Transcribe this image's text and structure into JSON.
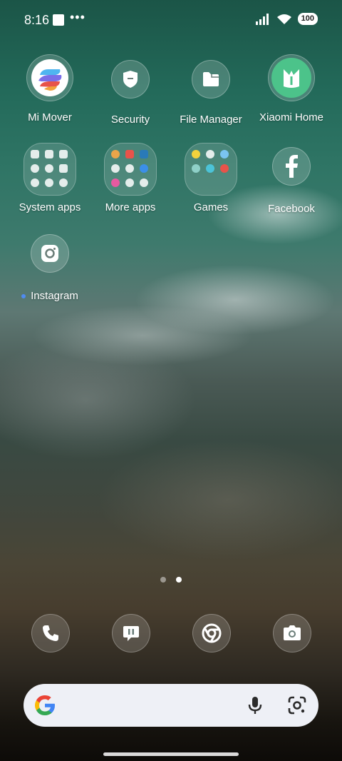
{
  "status_bar": {
    "time": "8:16",
    "overflow_indicator": "•••",
    "battery": "100"
  },
  "apps": {
    "row1": [
      {
        "label": "Mi Mover",
        "icon": "mi-mover-icon"
      },
      {
        "label": "Security",
        "icon": "security-shield-icon"
      },
      {
        "label": "File Manager",
        "icon": "folder-icon"
      },
      {
        "label": "Xiaomi Home",
        "icon": "xiaomi-home-icon"
      }
    ],
    "row2": [
      {
        "label": "System apps",
        "icon": "folder-grid-icon"
      },
      {
        "label": "More apps",
        "icon": "folder-grid-icon"
      },
      {
        "label": "Games",
        "icon": "folder-grid-icon"
      },
      {
        "label": "Facebook",
        "icon": "facebook-icon"
      }
    ],
    "row3": [
      {
        "label": "Instagram",
        "icon": "instagram-icon",
        "new_indicator": true
      }
    ]
  },
  "page_indicator": {
    "pages": 2,
    "current": 2
  },
  "dock": [
    {
      "name": "phone",
      "icon": "phone-icon"
    },
    {
      "name": "messages",
      "icon": "message-icon"
    },
    {
      "name": "chrome",
      "icon": "chrome-icon"
    },
    {
      "name": "camera",
      "icon": "camera-icon"
    }
  ],
  "search_bar": {
    "logo": "google-g-icon",
    "voice": "mic-icon",
    "lens": "lens-icon"
  },
  "colors": {
    "notification_dot": "#4f8bf0",
    "mi_mover_accent": "#e8534a",
    "xiaomi_home_green": "#4cc38a",
    "google_blue": "#4285f4",
    "google_red": "#ea4335",
    "google_yellow": "#fbbc05",
    "google_green": "#34a853"
  }
}
